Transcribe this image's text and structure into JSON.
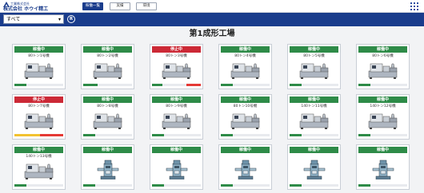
{
  "header": {
    "company_sub": "工業株式会社",
    "company_name": "株式会社 ホウイ精工",
    "nav": [
      {
        "label": "稼働一覧",
        "active": true
      },
      {
        "label": "実績",
        "active": false
      },
      {
        "label": "環境",
        "active": false
      }
    ],
    "menu_icon": "grid-menu-icon"
  },
  "filter": {
    "selected": "すべて",
    "reset_icon": "reset-r-icon"
  },
  "title": "第1成形工場",
  "colors": {
    "brand": "#1a3c8c",
    "running": "#2e8b48",
    "stopped": "#cc2936",
    "warning": "#f2c230",
    "danger": "#e53935"
  },
  "machines": [
    {
      "status": "稼働中",
      "state": "run",
      "name": "80トン1号機",
      "kind": "injection",
      "bar": [
        {
          "pct": 0.24,
          "color": "#2e8b48"
        }
      ]
    },
    {
      "status": "稼働中",
      "state": "run",
      "name": "80トン2号機",
      "kind": "injection",
      "bar": [
        {
          "pct": 0.3,
          "color": "#2e8b48"
        }
      ]
    },
    {
      "status": "停止中",
      "state": "stop",
      "name": "80トン3号機",
      "kind": "injection",
      "bar": [
        {
          "pct": 0.22,
          "color": "#2e8b48"
        },
        {
          "start": 0.7,
          "pct": 0.3,
          "color": "#e53935"
        }
      ]
    },
    {
      "status": "稼働中",
      "state": "run",
      "name": "80トン4号機",
      "kind": "injection",
      "bar": [
        {
          "pct": 0.24,
          "color": "#2e8b48"
        }
      ]
    },
    {
      "status": "稼働中",
      "state": "run",
      "name": "80トン5号機",
      "kind": "injection",
      "bar": [
        {
          "pct": 0.24,
          "color": "#2e8b48"
        }
      ]
    },
    {
      "status": "稼働中",
      "state": "run",
      "name": "80トン6号機",
      "kind": "injection",
      "bar": [
        {
          "pct": 0.24,
          "color": "#2e8b48"
        }
      ]
    },
    {
      "status": "停止中",
      "state": "stop",
      "name": "80トン7号機",
      "kind": "injection",
      "bar": [
        {
          "pct": 0.52,
          "color": "#f2c230"
        },
        {
          "start": 0.52,
          "pct": 0.48,
          "color": "#e53935"
        }
      ]
    },
    {
      "status": "稼働中",
      "state": "run",
      "name": "80トン8号機",
      "kind": "injection",
      "bar": [
        {
          "pct": 0.24,
          "color": "#2e8b48"
        }
      ]
    },
    {
      "status": "稼働中",
      "state": "run",
      "name": "80トン9号機",
      "kind": "injection",
      "bar": [
        {
          "pct": 0.24,
          "color": "#2e8b48"
        }
      ]
    },
    {
      "status": "稼働中",
      "state": "run",
      "name": "80トン10号機",
      "kind": "injection",
      "bar": [
        {
          "pct": 0.24,
          "color": "#2e8b48"
        }
      ]
    },
    {
      "status": "稼働中",
      "state": "run",
      "name": "140トン11号機",
      "kind": "injection",
      "bar": [
        {
          "pct": 0.24,
          "color": "#2e8b48"
        }
      ]
    },
    {
      "status": "稼働中",
      "state": "run",
      "name": "140トン12号機",
      "kind": "injection",
      "bar": [
        {
          "pct": 0.24,
          "color": "#2e8b48"
        }
      ]
    },
    {
      "status": "稼働中",
      "state": "run",
      "name": "140トン13号機",
      "kind": "injection",
      "bar": [
        {
          "pct": 0.24,
          "color": "#2e8b48"
        }
      ]
    },
    {
      "status": "稼働中",
      "state": "run",
      "name": "",
      "kind": "vertical",
      "bar": [
        {
          "pct": 0.24,
          "color": "#2e8b48"
        }
      ]
    },
    {
      "status": "稼働中",
      "state": "run",
      "name": "",
      "kind": "vertical",
      "bar": [
        {
          "pct": 0.24,
          "color": "#2e8b48"
        }
      ]
    },
    {
      "status": "稼働中",
      "state": "run",
      "name": "",
      "kind": "vertical",
      "bar": [
        {
          "pct": 0.24,
          "color": "#2e8b48"
        }
      ]
    },
    {
      "status": "稼働中",
      "state": "run",
      "name": "",
      "kind": "vertical",
      "bar": [
        {
          "pct": 0.24,
          "color": "#2e8b48"
        }
      ]
    },
    {
      "status": "稼働中",
      "state": "run",
      "name": "",
      "kind": "vertical",
      "bar": [
        {
          "pct": 0.24,
          "color": "#2e8b48"
        }
      ]
    }
  ]
}
